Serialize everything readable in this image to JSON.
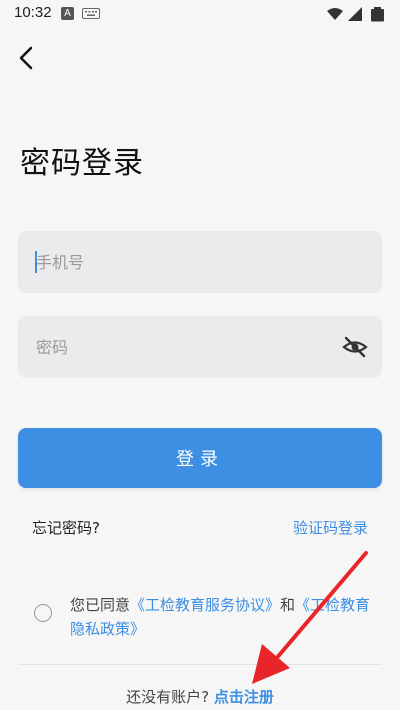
{
  "status_bar": {
    "time": "10:32",
    "notification_icon": "A",
    "icons": [
      "a-notification-icon",
      "keyboard-icon",
      "wifi-icon",
      "signal-icon",
      "battery-icon"
    ]
  },
  "header": {
    "back_icon": "chevron-left-icon"
  },
  "title": "密码登录",
  "phone_field": {
    "placeholder": "手机号",
    "value": ""
  },
  "password_field": {
    "placeholder": "密码",
    "value": "",
    "toggle_icon": "eye-off-icon"
  },
  "login_button": {
    "label": "登录"
  },
  "links": {
    "forgot_password": "忘记密码?",
    "code_login": "验证码登录"
  },
  "agreement": {
    "prefix": "您已同意",
    "service_agreement": "《工检教育服务协议》",
    "connector": "和",
    "privacy_policy": "《工检教育隐私政策》"
  },
  "register": {
    "prompt": "还没有账户?",
    "link": "点击注册"
  },
  "colors": {
    "accent": "#3d8fe3",
    "background": "#f6f6f7",
    "input_background": "#ebebee",
    "annotation_arrow": "#e8262a"
  }
}
